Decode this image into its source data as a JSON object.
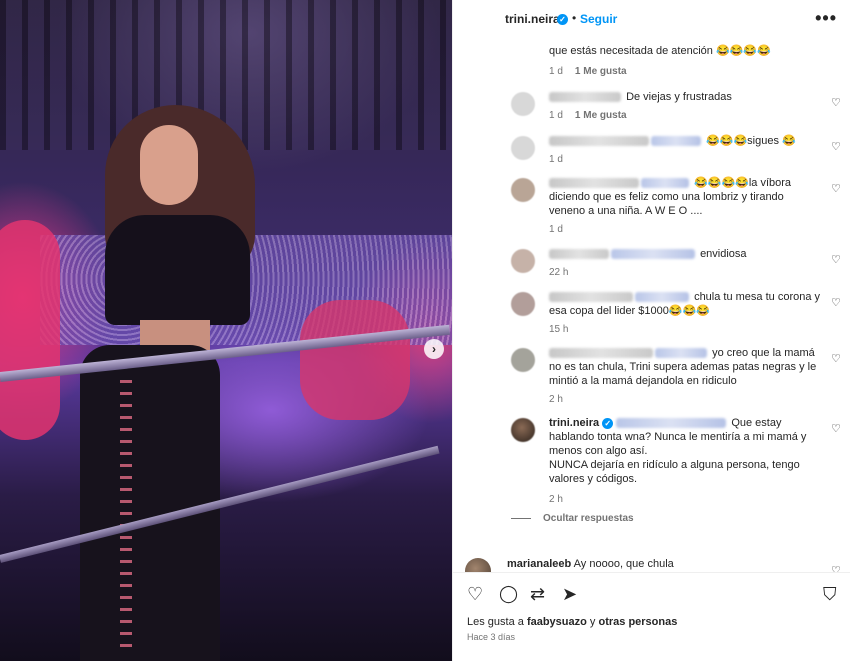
{
  "header": {
    "username": "trini.neira",
    "verified_icon": "✓",
    "dot": "•",
    "follow_label": "Seguir",
    "more_icon": "•••"
  },
  "photo": {
    "next_icon": "›"
  },
  "comments": [
    {
      "text": "que estás necesitada de atención 😂😂😂😂",
      "time": "1 d",
      "likes": "1 Me gusta"
    },
    {
      "text": "De viejas y frustradas",
      "time": "1 d",
      "likes": "1 Me gusta"
    },
    {
      "text": "😂😂😂sigues 😂",
      "time": "1 d",
      "likes": ""
    },
    {
      "text": "😂😂😂😂la víbora diciendo que es feliz como una lombriz y tirando veneno a una niña. A W E O ....",
      "time": "1 d",
      "likes": ""
    },
    {
      "text": "envidiosa",
      "time": "22 h",
      "likes": ""
    },
    {
      "text": "chula tu mesa tu corona y esa copa del lider $1000😂😂😂",
      "time": "15 h",
      "likes": ""
    },
    {
      "text": "yo creo que la mamá no es tan chula, Trini supera ademas patas negras y le mintió a la mamá dejandola en ridiculo",
      "time": "2 h",
      "likes": ""
    }
  ],
  "reply": {
    "username": "trini.neira",
    "text1": "Que estay hablando tonta wna? Nunca le mentiría a mi mamá y menos con algo así.",
    "text2": "NUNCA dejaría en ridículo a alguna persona, tengo valores y códigos.",
    "time": "2 h"
  },
  "hide_replies_label": "Ocultar respuestas",
  "last_comment": {
    "username": "marianaleeb",
    "text": "Ay noooo, que chula"
  },
  "heart_icon": "♡",
  "footer": {
    "like_icon": "♡",
    "comment_icon": "◯",
    "share_icon": "⇄",
    "send_icon": "➤",
    "save_icon": "⛉",
    "likes_prefix": "Les gusta a ",
    "likes_user": "faabysuazo",
    "likes_middle": " y ",
    "likes_others": "otras personas",
    "date": "Hace 3 días"
  },
  "colors": {
    "accent": "#0095f6",
    "text": "#262626",
    "muted": "#737373"
  }
}
